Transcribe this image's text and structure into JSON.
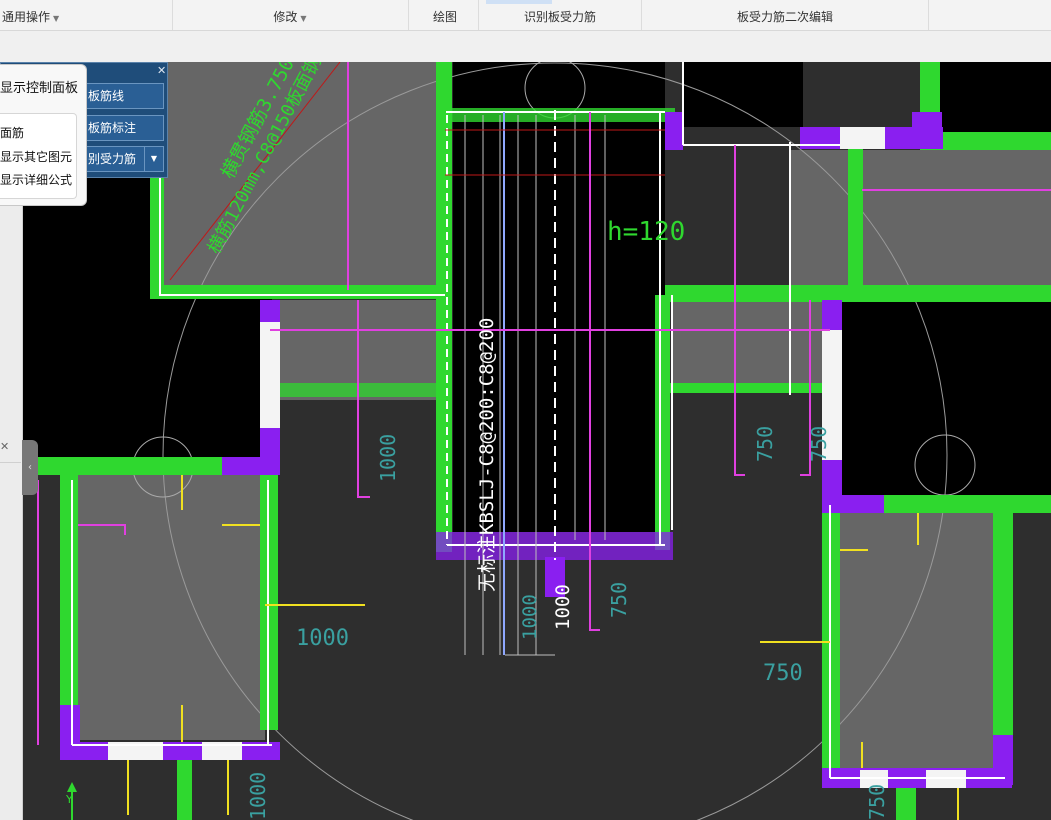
{
  "ribbon": {
    "general": "通用操作",
    "modify": "修改",
    "draw": "绘图",
    "identify": "识别板受力筋",
    "edit": "板受力筋二次编辑"
  },
  "panel": {
    "btn1": "板筋线",
    "btn2": "板筋标注",
    "btn3": "别受力筋"
  },
  "popup": {
    "title": "显示控制面板",
    "item1": "面筋",
    "item2": "显示其它图元",
    "item3": "显示详细公式"
  },
  "cad": {
    "diag1": "横贯钢筋3.750",
    "diag2": "横筋120mm,C8@150板面钢筋",
    "h": "h=120",
    "rebar": "无标注KBSLJ-C8@200:C8@200",
    "dims": [
      "1000",
      "1000",
      "1000",
      "1000",
      "750",
      "750",
      "750",
      "750",
      "1000",
      "750"
    ],
    "axis_y": "Y"
  },
  "colors": {
    "wall": "#2fd82f",
    "column": "#8a1ff0",
    "rebar": "#e040e0",
    "dim": "#3aa0a0",
    "yellow": "#f0e020"
  }
}
